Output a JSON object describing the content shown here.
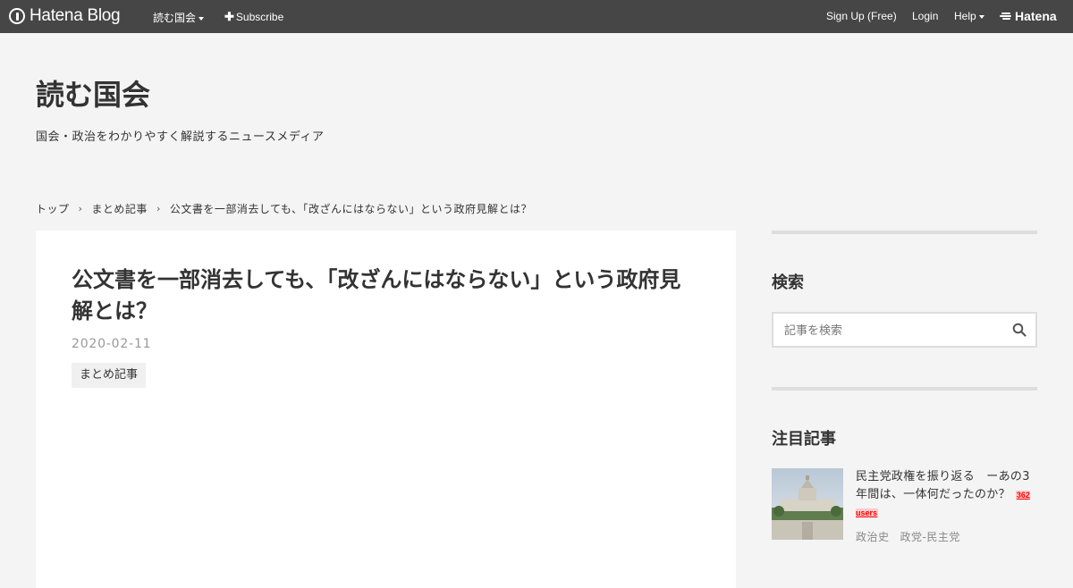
{
  "topbar": {
    "brand": "Hatena Blog",
    "blog_name": "読む国会",
    "subscribe_label": "Subscribe",
    "signup_label": "Sign Up (Free)",
    "login_label": "Login",
    "help_label": "Help",
    "hatena_label": "Hatena"
  },
  "blog": {
    "title": "読む国会",
    "description": "国会・政治をわかりやすく解説するニュースメディア"
  },
  "breadcrumb": {
    "items": [
      "トップ",
      "まとめ記事",
      "公文書を一部消去しても、「改ざんにはならない」という政府見解とは？"
    ]
  },
  "entry": {
    "title": "公文書を一部消去しても、「改ざんにはならない」という政府見解とは？",
    "date": "2020-02-11",
    "category": "まとめ記事"
  },
  "sidebar": {
    "search_heading": "検索",
    "search_placeholder": "記事を検索",
    "featured_heading": "注目記事",
    "featured": {
      "title": "民主党政権を振り返る　ーあの3年間は、一体何だったのか？",
      "users": "362 users",
      "categories": [
        "政治史",
        "政党-民主党"
      ]
    }
  },
  "colors": {
    "topbar_bg": "#464646",
    "page_bg": "#f4f4f4",
    "users_badge": "#ff0000"
  }
}
